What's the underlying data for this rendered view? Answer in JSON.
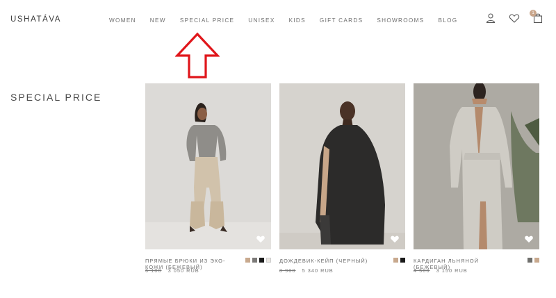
{
  "header": {
    "logo": "USHATÁVA",
    "nav": [
      "WOMEN",
      "NEW",
      "SPECIAL PRICE",
      "UNISEX",
      "KIDS",
      "GIFT CARDS",
      "SHOWROOMS",
      "BLOG"
    ],
    "icons": [
      "user-icon",
      "heart-icon",
      "bag-icon"
    ],
    "cart_count": "1"
  },
  "page": {
    "title": "SPECIAL PRICE"
  },
  "annotation_color": "#e0161b",
  "products": [
    {
      "name": "ПРЯМЫЕ БРЮКИ ИЗ ЭКО-КОЖИ (БЕЖЕВЫЙ)",
      "old_price": "6 100",
      "price": "3 050 RUB",
      "swatches": [
        "#c8a98e",
        "#7c7a78",
        "#1a1a1a",
        "#ebe7e2"
      ]
    },
    {
      "name": "ДОЖДЕВИК-КЕЙП (ЧЕРНЫЙ)",
      "old_price": "8 900",
      "price": "5 340 RUB",
      "swatches": [
        "#c8a98e",
        "#1a1a1a"
      ]
    },
    {
      "name": "КАРДИГАН ЛЬНЯНОЙ (БЕЖЕВЫЙ)",
      "old_price": "4 500",
      "price": "3 150 RUB",
      "swatches": [
        "#6f6f6c",
        "#c8a98e"
      ]
    }
  ]
}
